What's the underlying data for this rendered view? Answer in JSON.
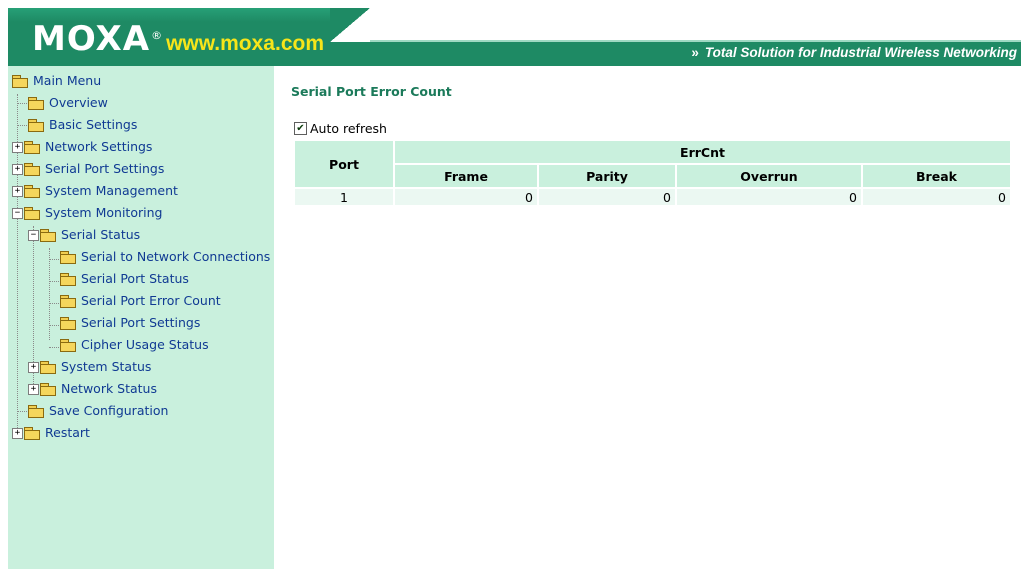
{
  "header": {
    "logo": "MOXA",
    "logo_mark": "®",
    "url": "www.moxa.com",
    "tagline_arrows": "»",
    "tagline": "Total Solution for Industrial Wireless Networking"
  },
  "sidebar": {
    "items": [
      {
        "label": "Main Menu"
      },
      {
        "label": "Overview"
      },
      {
        "label": "Basic Settings"
      },
      {
        "label": "Network Settings"
      },
      {
        "label": "Serial Port Settings"
      },
      {
        "label": "System Management"
      },
      {
        "label": "System Monitoring"
      },
      {
        "label": "Serial Status"
      },
      {
        "label": "Serial to Network Connections"
      },
      {
        "label": "Serial Port Status"
      },
      {
        "label": "Serial Port Error Count"
      },
      {
        "label": "Serial Port Settings"
      },
      {
        "label": "Cipher Usage Status"
      },
      {
        "label": "System Status"
      },
      {
        "label": "Network Status"
      },
      {
        "label": "Save Configuration"
      },
      {
        "label": "Restart"
      }
    ],
    "expand": "+",
    "collapse": "−"
  },
  "main": {
    "title": "Serial Port Error Count",
    "auto_refresh_label": "Auto refresh",
    "auto_refresh_mark": "✔",
    "table": {
      "port_header": "Port",
      "group_header": "ErrCnt",
      "columns": [
        "Frame",
        "Parity",
        "Overrun",
        "Break"
      ],
      "rows": [
        {
          "port": "1",
          "values": [
            "0",
            "0",
            "0",
            "0"
          ]
        }
      ]
    }
  },
  "colors": {
    "header_green": "#1e8a64",
    "sidebar_bg": "#c9f0dd",
    "link": "#103a93",
    "title": "#1b7a5a",
    "url_yellow": "#f7e51a"
  },
  "icons": {
    "folder": "folder-icon",
    "folder_open": "folder-open-icon",
    "expand": "plus-box-icon",
    "collapse": "minus-box-icon",
    "checkbox": "checkbox-checked-icon"
  }
}
